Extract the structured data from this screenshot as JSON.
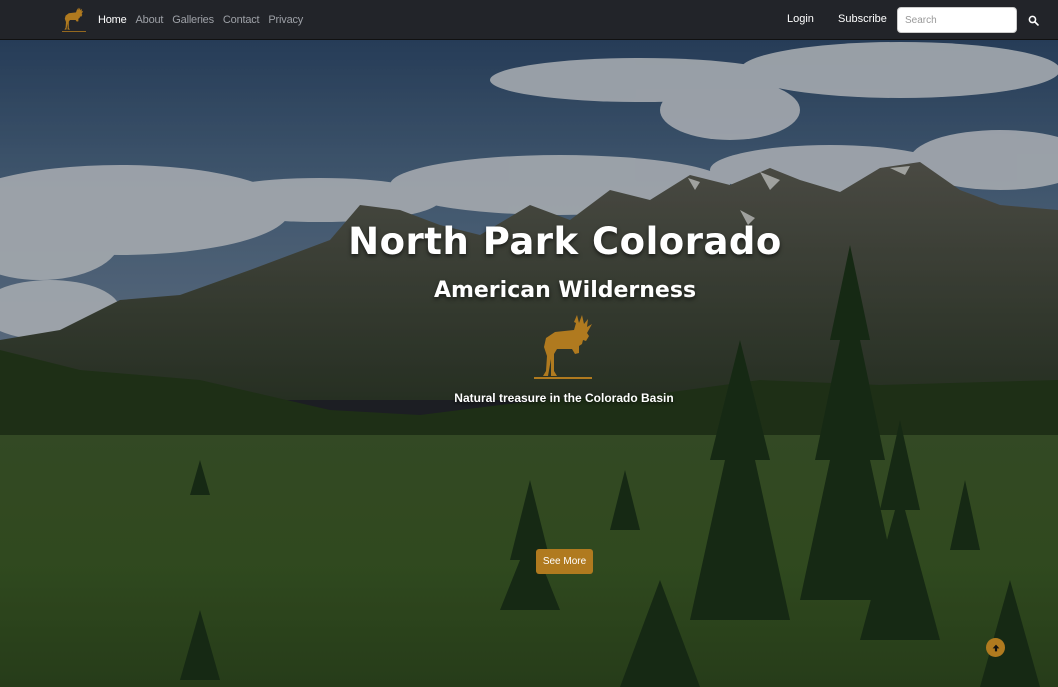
{
  "nav": {
    "links": [
      {
        "label": "Home",
        "active": true
      },
      {
        "label": "About",
        "active": false
      },
      {
        "label": "Galleries",
        "active": false
      },
      {
        "label": "Contact",
        "active": false
      },
      {
        "label": "Privacy",
        "active": false
      }
    ],
    "login_label": "Login",
    "subscribe_label": "Subscribe",
    "search_placeholder": "Search",
    "search_value": "",
    "brand_icon": "moose-icon",
    "search_icon": "search-icon"
  },
  "hero": {
    "title": "North Park Colorado",
    "subtitle": "American Wilderness",
    "logo_icon": "moose-icon",
    "tagline": "Natural treasure in the Colorado Basin",
    "cta_label": "See More",
    "scroll_top_icon": "arrow-up-icon"
  },
  "colors": {
    "navbar_bg": "#222429",
    "accent": "#b07a1f",
    "text_on_hero": "#ffffff",
    "nav_link_inactive": "#9da0a6"
  }
}
